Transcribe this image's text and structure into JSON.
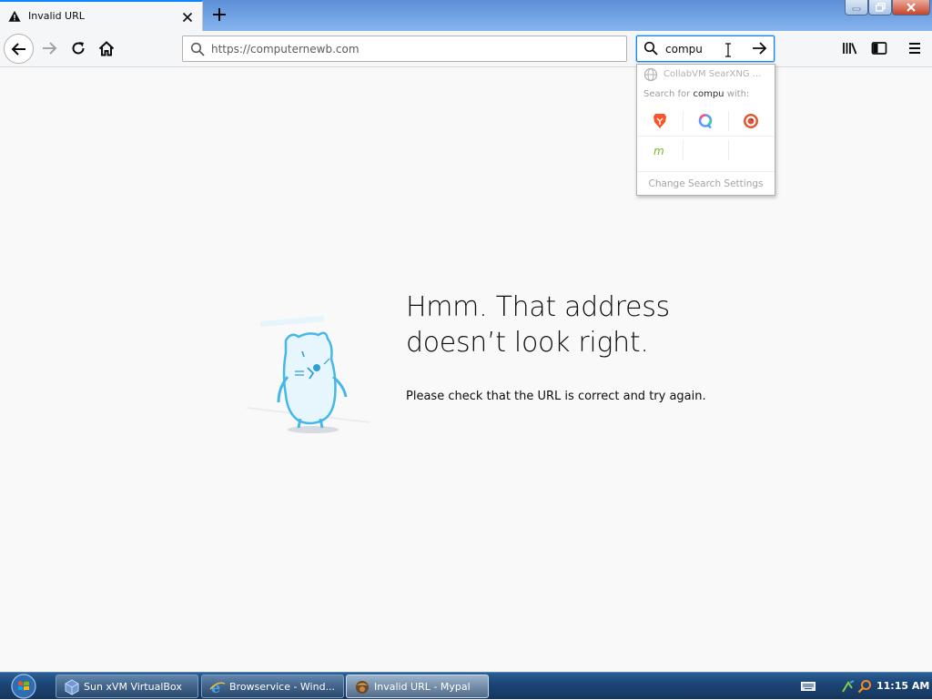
{
  "tab": {
    "title": "Invalid URL",
    "close_symbol": "×",
    "new_tab_symbol": "+"
  },
  "nav": {
    "url": "https://computernewb.com",
    "search_value": "compu"
  },
  "search_popup": {
    "engine_header": "CollabVM SearXNG ...",
    "search_for_prefix": "Search for ",
    "search_for_query": "compu",
    "search_for_suffix": " with:",
    "engines": [
      "brave-icon",
      "qwant-icon",
      "duckduckgo-icon",
      "mojeek-icon"
    ],
    "settings_label": "Change Search Settings"
  },
  "error": {
    "title_line1": "Hmm. That address",
    "title_line2": "doesn’t look right.",
    "description": "Please check that the URL is correct and try again."
  },
  "taskbar": {
    "items": [
      {
        "label": "Sun xVM VirtualBox",
        "icon": "virtualbox-icon",
        "active": false
      },
      {
        "label": "Browservice - Wind...",
        "icon": "ie-icon",
        "active": false
      },
      {
        "label": "Invalid URL - Mypal",
        "icon": "mypal-icon",
        "active": true
      }
    ],
    "clock": "11:15 AM"
  },
  "colors": {
    "accent": "#0a84ff",
    "page_bg": "#f9f9fa",
    "taskbar": "#1b4676"
  }
}
